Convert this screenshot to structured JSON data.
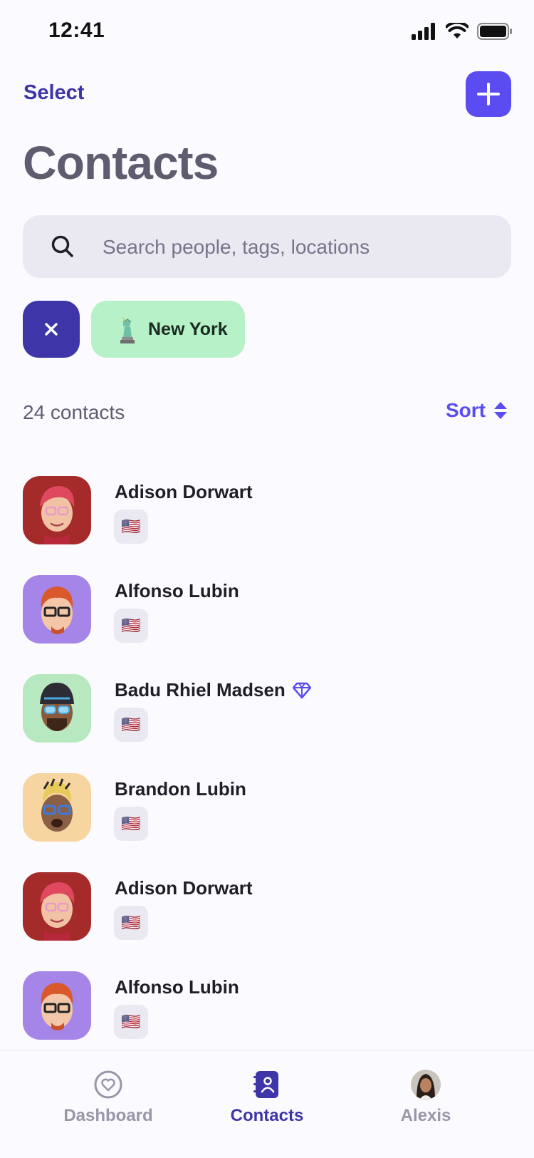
{
  "status_bar": {
    "time": "12:41"
  },
  "header": {
    "select_label": "Select",
    "title": "Contacts"
  },
  "search": {
    "placeholder": "Search people, tags, locations",
    "value": ""
  },
  "filters": {
    "active": [
      {
        "label": "New York",
        "icon": "statue-of-liberty-icon"
      }
    ]
  },
  "summary": {
    "count_text": "24 contacts",
    "sort_label": "Sort"
  },
  "contacts": [
    {
      "name": "Adison Dorwart",
      "flag": "🇺🇸",
      "avatar_bg": "#A52A2A",
      "badge": null
    },
    {
      "name": "Alfonso Lubin",
      "flag": "🇺🇸",
      "avatar_bg": "#A585E8",
      "badge": null
    },
    {
      "name": "Badu Rhiel Madsen",
      "flag": "🇺🇸",
      "avatar_bg": "#B8E8BF",
      "badge": "diamond-icon"
    },
    {
      "name": "Brandon Lubin",
      "flag": "🇺🇸",
      "avatar_bg": "#F6D5A0",
      "badge": null
    },
    {
      "name": "Adison Dorwart",
      "flag": "🇺🇸",
      "avatar_bg": "#A52A2A",
      "badge": null
    },
    {
      "name": "Alfonso Lubin",
      "flag": "🇺🇸",
      "avatar_bg": "#A585E8",
      "badge": null
    }
  ],
  "tabs": [
    {
      "label": "Dashboard",
      "icon": "heart-circle-icon",
      "active": false
    },
    {
      "label": "Contacts",
      "icon": "contact-book-icon",
      "active": true
    },
    {
      "label": "Alexis",
      "icon": "profile-avatar-icon",
      "active": false
    }
  ],
  "colors": {
    "accent": "#5B4CF2",
    "accent_dark": "#3D35A8",
    "chip_green": "#B6F1C8",
    "inactive_tab": "#9896A8",
    "background": "#FBFAFE"
  }
}
